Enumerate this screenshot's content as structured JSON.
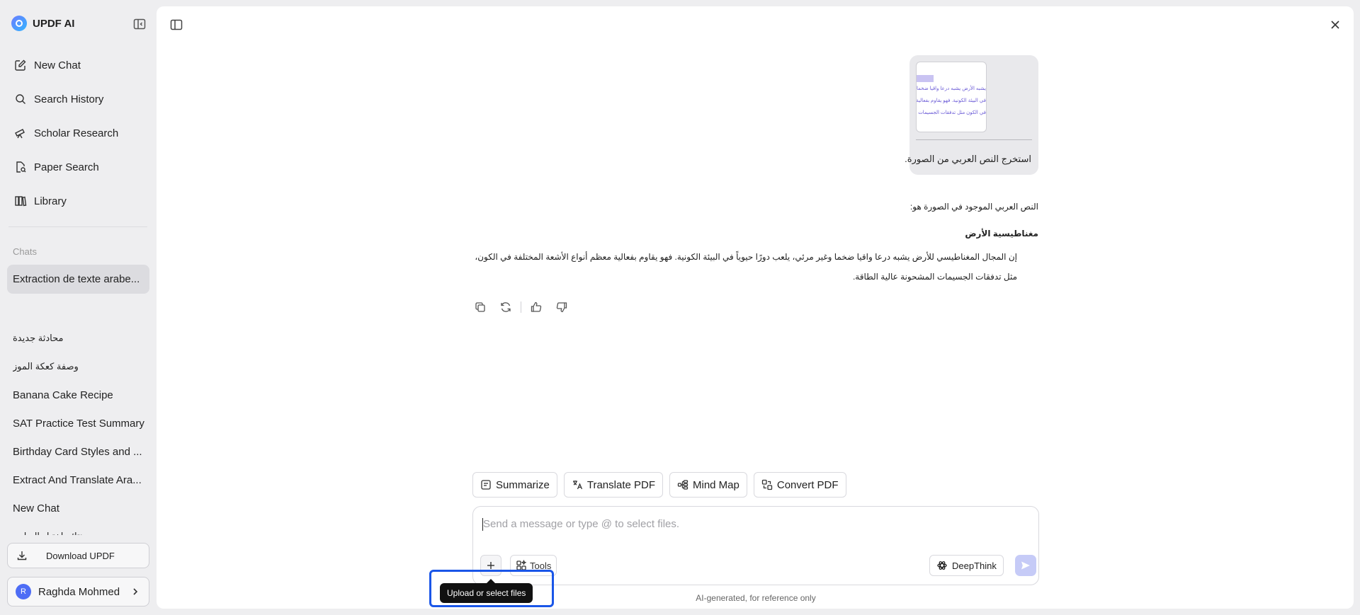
{
  "sidebar": {
    "brand": "UPDF AI",
    "nav": [
      {
        "label": "New Chat",
        "icon": "edit-icon"
      },
      {
        "label": "Search History",
        "icon": "search-icon"
      },
      {
        "label": "Scholar Research",
        "icon": "telescope-icon"
      },
      {
        "label": "Paper Search",
        "icon": "document-search-icon"
      },
      {
        "label": "Library",
        "icon": "library-icon"
      }
    ],
    "chats_label": "Chats",
    "active_chat": "Extraction de texte arabe...",
    "history": [
      "محادثة جديدة",
      "وصفة كعكة الموز",
      "Banana Cake Recipe",
      "SAT Practice Test Summary",
      "Birthday Card Styles and ...",
      "Extract And Translate Ara...",
      "New Chat",
      "نتائج اختبار الرياض"
    ],
    "download_label": "Download UPDF",
    "user": {
      "initial": "R",
      "name": "Raghda Mohmed"
    }
  },
  "conversation": {
    "user_message": {
      "thumbnail_lines": [
        "يشبه الأرض يشبه درعا واقيا ضخما",
        "في البيئة الكونية. فهو يقاوم بفعالية",
        "في الكون مثل تدفقات الجسيمات ا"
      ],
      "text": "استخرج النص العربي من الصورة."
    },
    "reply": {
      "intro": "النص العربي الموجود في الصورة هو:",
      "heading": "مغناطيسية الأرض",
      "body": "إن المجال المغناطيسي للأرض يشبه درعا واقيا ضخما وغير مرئي، يلعب دورًا حيوياً في البيئة الكونية. فهو يقاوم بفعالية معظم أنواع الأشعة المختلفة في الكون، مثل تدفقات الجسيمات المشحونة عالية الطاقة."
    }
  },
  "quick_actions": [
    "Summarize",
    "Translate PDF",
    "Mind Map",
    "Convert PDF"
  ],
  "composer": {
    "placeholder": "Send a message or type @ to select files.",
    "tools_label": "Tools",
    "deepthink_label": "DeepThink",
    "footnote": "AI-generated, for reference only"
  },
  "tooltip": "Upload or select files",
  "colors": {
    "accent": "#1a56e8",
    "send_disabled": "#c6cbf7",
    "active_chat_bg": "#dcdce0"
  }
}
